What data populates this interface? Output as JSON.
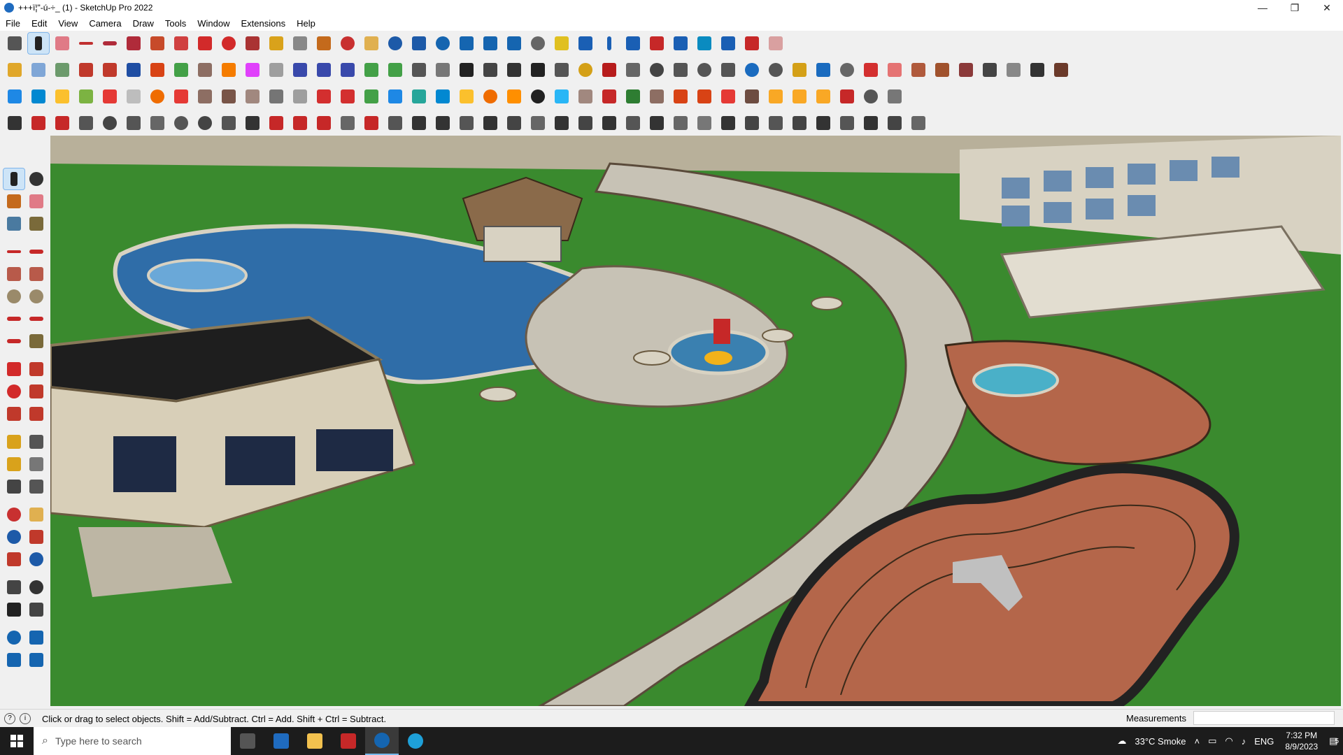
{
  "window": {
    "title": "+++ï¦\"-ú-÷_ (1) - SketchUp Pro 2022",
    "minimize": "—",
    "maximize": "❐",
    "close": "✕"
  },
  "menu": {
    "items": [
      "File",
      "Edit",
      "View",
      "Camera",
      "Draw",
      "Tools",
      "Window",
      "Extensions",
      "Help"
    ]
  },
  "status": {
    "message": "Click or drag to select objects. Shift = Add/Subtract. Ctrl = Add. Shift + Ctrl = Subtract.",
    "measurements_label": "Measurements",
    "measurements_value": ""
  },
  "taskbar": {
    "search_placeholder": "Type here to search",
    "weather": "33°C  Smoke",
    "language": "ENG",
    "time": "7:32 PM",
    "date": "8/9/2023",
    "notification_count": "5"
  },
  "colors": {
    "accent": "#0078d7",
    "grass": "#3a8a2e",
    "water": "#2f6da8",
    "paving": "#c7c2b5",
    "track": "#b4664a"
  }
}
